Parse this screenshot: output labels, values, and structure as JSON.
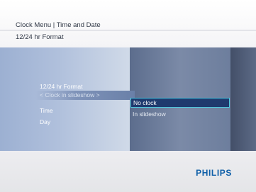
{
  "header": {
    "breadcrumb": "Clock Menu | Time and Date",
    "subtitle": "12/24 hr Format"
  },
  "menu": {
    "items": [
      {
        "label": "12/24 hr Format"
      },
      {
        "label": "< Clock in slideshow >",
        "highlighted": true
      },
      {
        "label": "Time"
      },
      {
        "label": "Day"
      }
    ]
  },
  "submenu": {
    "options": [
      {
        "label": "No clock",
        "selected": true
      },
      {
        "label": "In slideshow"
      }
    ]
  },
  "footer": {
    "brand": "PHILIPS"
  },
  "colors": {
    "accent_border": "#4ec9df",
    "selected_fill": "#1f3a6e",
    "brand_blue": "#0e5fa8"
  }
}
